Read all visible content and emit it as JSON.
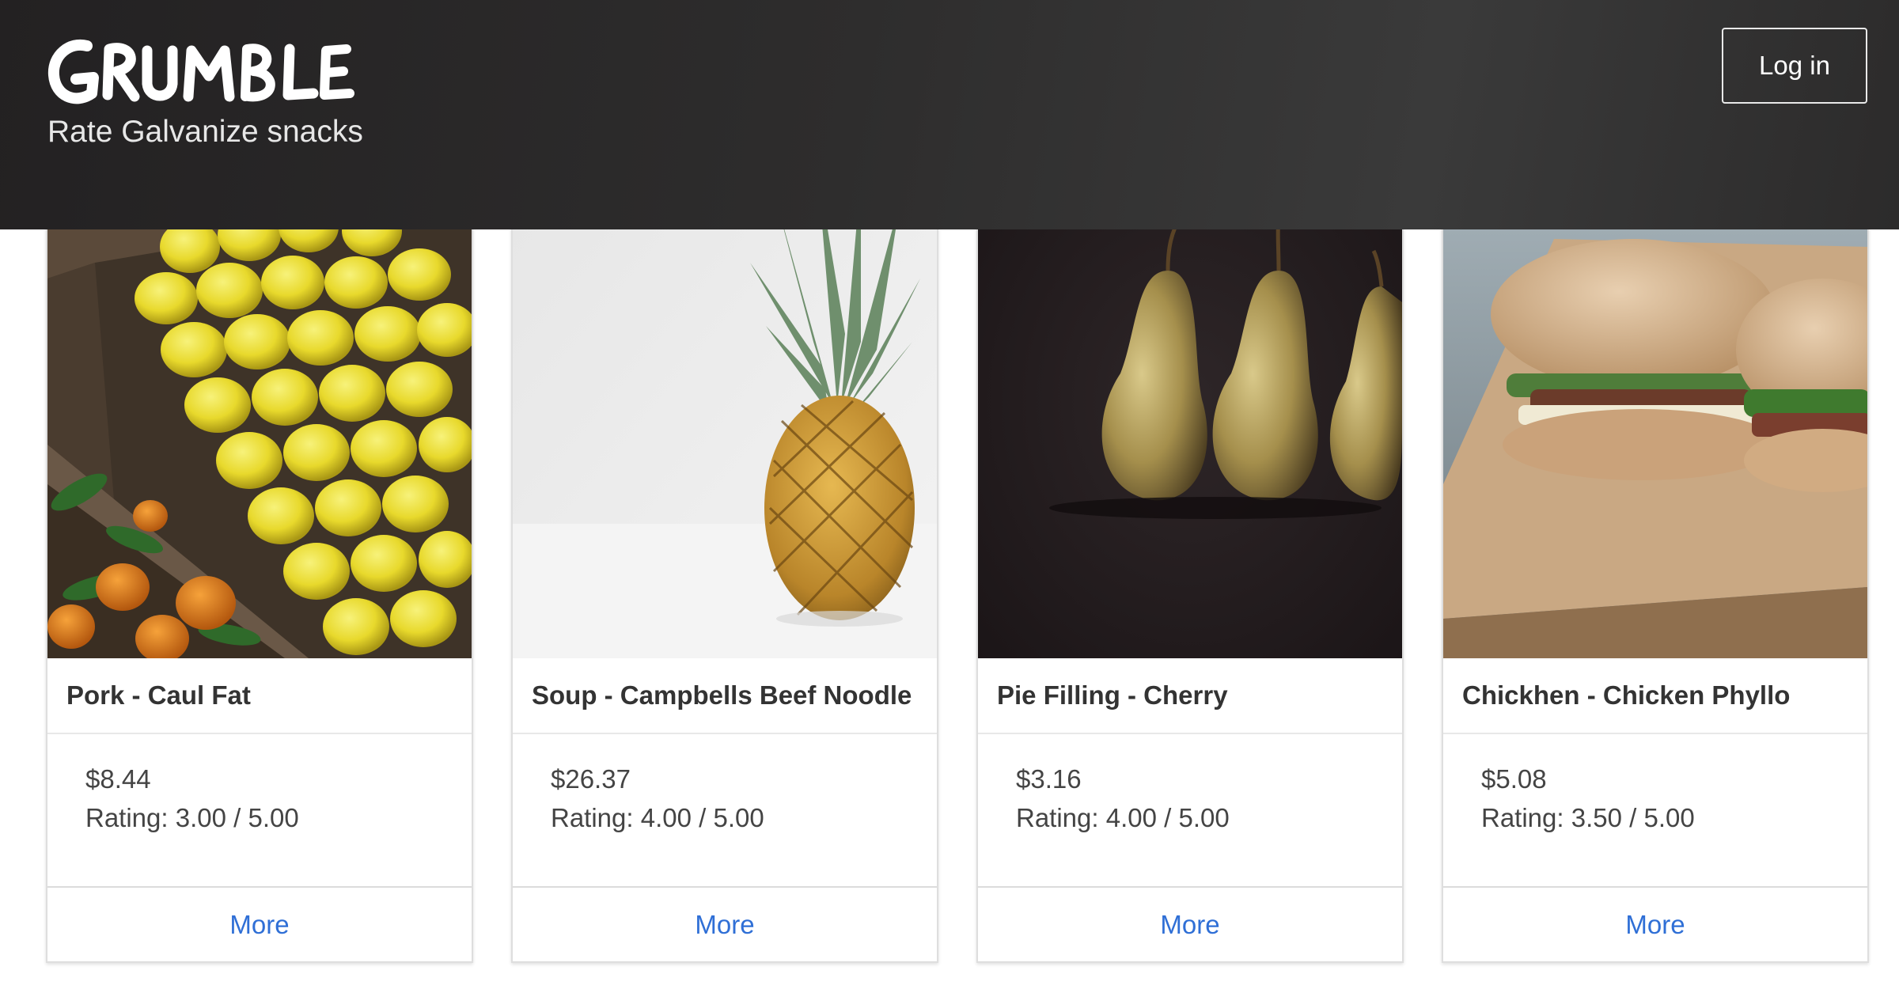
{
  "header": {
    "logo_text": "GRUMBLE",
    "tagline": "Rate Galvanize snacks",
    "login_label": "Log in"
  },
  "cards": [
    {
      "name": "Pork - Caul Fat",
      "price": "$8.44",
      "rating": "Rating: 3.00 / 5.00",
      "more_label": "More",
      "image_subject": "lemons-in-crate"
    },
    {
      "name": "Soup - Campbells Beef Noodle",
      "price": "$26.37",
      "rating": "Rating: 4.00 / 5.00",
      "more_label": "More",
      "image_subject": "pineapple"
    },
    {
      "name": "Pie Filling - Cherry",
      "price": "$3.16",
      "rating": "Rating: 4.00 / 5.00",
      "more_label": "More",
      "image_subject": "pears"
    },
    {
      "name": "Chickhen - Chicken Phyllo",
      "price": "$5.08",
      "rating": "Rating: 3.50 / 5.00",
      "more_label": "More",
      "image_subject": "burgers"
    }
  ]
}
